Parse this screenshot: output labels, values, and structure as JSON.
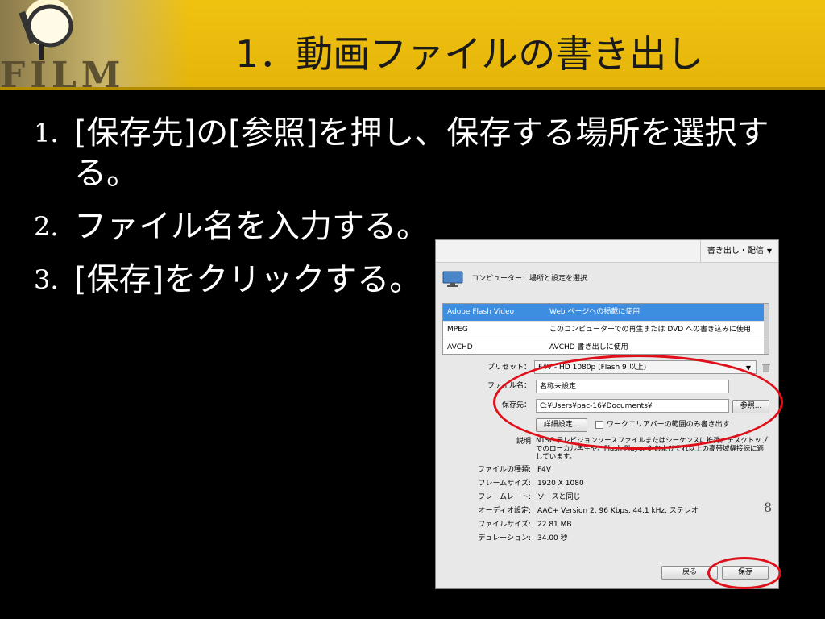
{
  "slide": {
    "title": "1．動画ファイルの書き出し",
    "banner_text": "FILM",
    "page_number": "8"
  },
  "steps": [
    {
      "number": "1.",
      "text": "[保存先]の[参照]を押し、保存する場所を選択する。"
    },
    {
      "number": "2.",
      "text": "ファイル名を入力する。"
    },
    {
      "number": "3.",
      "text": "[保存]をクリックする。"
    }
  ],
  "dialog": {
    "menu_label": "書き出し・配信",
    "heading": "コンピューター：場所と設定を選択",
    "formats": [
      {
        "name": "Adobe Flash Video",
        "desc": "Web ページへの掲載に使用",
        "selected": true
      },
      {
        "name": "MPEG",
        "desc": "このコンピューターでの再生または DVD への書き込みに使用",
        "selected": false
      },
      {
        "name": "AVCHD",
        "desc": "AVCHD 書き出しに使用",
        "selected": false
      }
    ],
    "preset": {
      "label": "プリセット：",
      "value": "F4V - HD 1080p (Flash 9 以上)"
    },
    "filename": {
      "label": "ファイル名：",
      "value": "名称未設定"
    },
    "save_to": {
      "label": "保存先：",
      "value": "C:¥Users¥pac-16¥Documents¥",
      "browse_label": "参照..."
    },
    "advanced_label": "詳細設定...",
    "work_area_label": "ワークエリアバーの範囲のみ書き出す",
    "description": {
      "label": "説明",
      "value": "NTSC テレビジョンソースファイルまたはシーケンスに推奨。デスクトップでのローカル再生や、Flash Player 9 およびそれ以上の高帯域幅接続に適しています。"
    },
    "info": [
      {
        "label": "ファイルの種類:",
        "value": "F4V"
      },
      {
        "label": "フレームサイズ:",
        "value": "1920 X 1080"
      },
      {
        "label": "フレームレート:",
        "value": "ソースと同じ"
      },
      {
        "label": "オーディオ設定:",
        "value": "AAC+ Version 2, 96 Kbps, 44.1 kHz, ステレオ"
      },
      {
        "label": "ファイルサイズ:",
        "value": "22.81 MB"
      },
      {
        "label": "デュレーション:",
        "value": "34.00 秒"
      }
    ],
    "back_label": "戻る",
    "save_label": "保存"
  },
  "colors": {
    "header": "#e5b40a",
    "selection": "#3d8de0",
    "annotation": "#e0101a"
  }
}
